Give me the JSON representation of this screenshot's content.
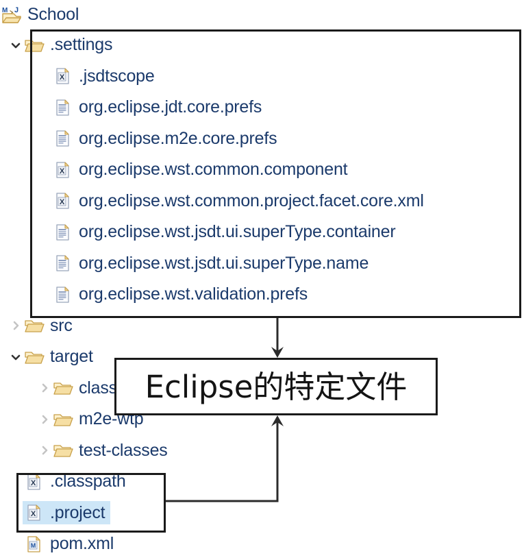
{
  "window": {
    "kind": "eclipse-package-explorer-tree"
  },
  "tree": {
    "root": {
      "label": "School",
      "icon": "maven-java-project-icon",
      "twisty": "none"
    },
    "nodes": [
      {
        "label": ".settings",
        "icon": "folder-open-icon",
        "twisty": "expanded",
        "indent": 0,
        "selected": false
      },
      {
        "label": ".jsdtscope",
        "icon": "xml-file-icon",
        "twisty": "none",
        "indent": 1,
        "selected": false
      },
      {
        "label": "org.eclipse.jdt.core.prefs",
        "icon": "prefs-file-icon",
        "twisty": "none",
        "indent": 1,
        "selected": false
      },
      {
        "label": "org.eclipse.m2e.core.prefs",
        "icon": "prefs-file-icon",
        "twisty": "none",
        "indent": 1,
        "selected": false
      },
      {
        "label": "org.eclipse.wst.common.component",
        "icon": "xml-file-icon",
        "twisty": "none",
        "indent": 1,
        "selected": false
      },
      {
        "label": "org.eclipse.wst.common.project.facet.core.xml",
        "icon": "xml-file-icon",
        "twisty": "none",
        "indent": 1,
        "selected": false
      },
      {
        "label": "org.eclipse.wst.jsdt.ui.superType.container",
        "icon": "prefs-file-icon",
        "twisty": "none",
        "indent": 1,
        "selected": false
      },
      {
        "label": "org.eclipse.wst.jsdt.ui.superType.name",
        "icon": "prefs-file-icon",
        "twisty": "none",
        "indent": 1,
        "selected": false
      },
      {
        "label": "org.eclipse.wst.validation.prefs",
        "icon": "prefs-file-icon",
        "twisty": "none",
        "indent": 1,
        "selected": false
      },
      {
        "label": "src",
        "icon": "folder-open-icon",
        "twisty": "collapsed",
        "indent": 0,
        "selected": false
      },
      {
        "label": "target",
        "icon": "folder-open-icon",
        "twisty": "expanded",
        "indent": 0,
        "selected": false
      },
      {
        "label": "classes",
        "icon": "folder-open-icon",
        "twisty": "collapsed",
        "indent": 3,
        "selected": false
      },
      {
        "label": "m2e-wtp",
        "icon": "folder-open-icon",
        "twisty": "collapsed",
        "indent": 3,
        "selected": false
      },
      {
        "label": "test-classes",
        "icon": "folder-open-icon",
        "twisty": "collapsed",
        "indent": 3,
        "selected": false
      },
      {
        "label": ".classpath",
        "icon": "xml-file-icon",
        "twisty": "none",
        "indent": 0,
        "selected": false
      },
      {
        "label": ".project",
        "icon": "xml-file-icon",
        "twisty": "none",
        "indent": 0,
        "selected": true
      },
      {
        "label": "pom.xml",
        "icon": "maven-pom-icon",
        "twisty": "none",
        "indent": 0,
        "selected": false
      }
    ]
  },
  "annotation": {
    "text": "Eclipse的特定文件",
    "border_color": "#1a1a1a",
    "background": "#ffffff"
  },
  "highlight_boxes": [
    {
      "name": "settings-folder-highlight",
      "label_target": ".settings"
    },
    {
      "name": "project-files-highlight",
      "label_target": ".classpath / .project"
    }
  ],
  "colors": {
    "tree_label": "#1b3a6b",
    "selection": "#cde6f7",
    "box_outline": "#1a1a1a",
    "folder_fill": "#f5d89a",
    "folder_stroke": "#b8860b",
    "twisty_expanded": "#333333",
    "twisty_collapsed": "#c4c4c4"
  }
}
